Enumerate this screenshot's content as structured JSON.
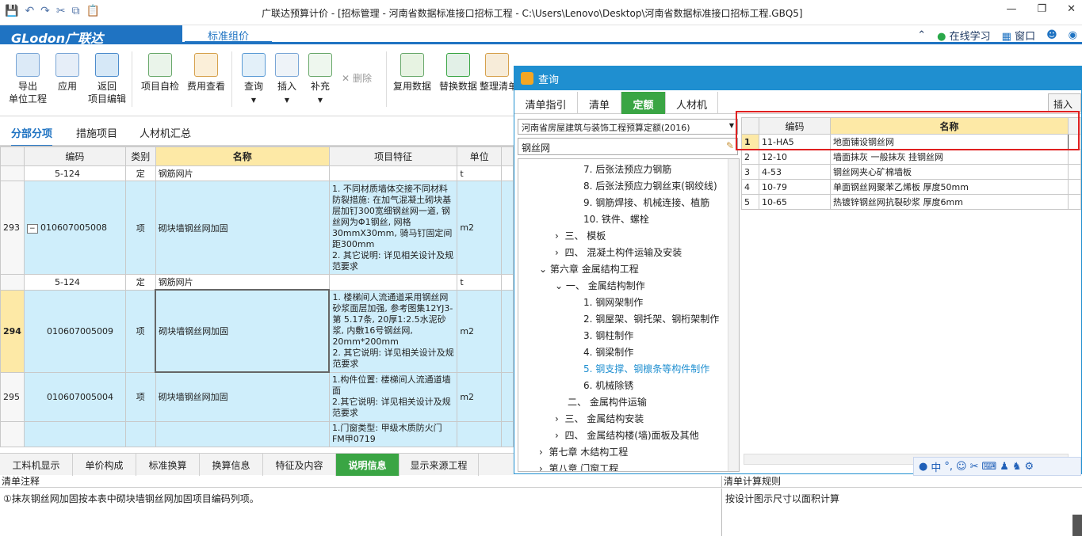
{
  "window": {
    "title": "广联达预算计价 - [招标管理 - 河南省数据标准接口招标工程 - C:\\Users\\Lenovo\\Desktop\\河南省数据标准接口招标工程.GBQ5]"
  },
  "brand": {
    "logo": "GLodon广联达",
    "tab_std": "标准组价",
    "online": "在线学习",
    "window": "窗口"
  },
  "ribbon": {
    "buttons": [
      "导出\n单位工程",
      "应用",
      "返回\n项目编辑",
      "项目自检",
      "费用查看",
      "查询",
      "插入",
      "补充",
      "删除",
      "复用数据",
      "替换数据",
      "整理清单"
    ]
  },
  "subtabs": [
    "分部分项",
    "措施项目",
    "人材机汇总"
  ],
  "grid": {
    "columns": [
      "编码",
      "类别",
      "名称",
      "项目特征",
      "单位"
    ],
    "rows": [
      {
        "num": "",
        "code": "5-124",
        "type": "定",
        "name": "钢筋网片",
        "feature": "",
        "unit": "t",
        "sub": true
      },
      {
        "num": "293",
        "code": "010607005008",
        "type": "项",
        "name": "砌块墙钢丝网加固",
        "feature": "1. 不同材质墙体交接不同材料防裂措施: 在加气混凝土砌块基层加钉300宽细钢丝网一道, 钢丝网为Φ1钢丝, 网格30mmX30mm, 骑马钉固定间距300mm\n2. 其它说明: 详见相关设计及规范要求",
        "unit": "m2",
        "sub": false
      },
      {
        "num": "",
        "code": "5-124",
        "type": "定",
        "name": "钢筋网片",
        "feature": "",
        "unit": "t",
        "sub": true
      },
      {
        "num": "294",
        "code": "010607005009",
        "type": "项",
        "name": "砌块墙钢丝网加固",
        "feature": "1. 楼梯间人流通道采用钢丝网砂浆面层加强, 参考图集12YJ3-第 5.17条, 20厚1:2.5水泥砂浆, 内敷16号钢丝网, 20mm*200mm\n2. 其它说明: 详见相关设计及规范要求",
        "unit": "m2",
        "sub": false
      },
      {
        "num": "295",
        "code": "010607005004",
        "type": "项",
        "name": "砌块墙钢丝网加固",
        "feature": "1.构件位置: 楼梯间人流通道墙面\n2.其它说明: 详见相关设计及规范要求",
        "unit": "m2",
        "sub": false
      },
      {
        "num": "",
        "code": "",
        "type": "",
        "name": "",
        "feature": "1.门窗类型: 甲级木质防火门FM甲0719",
        "unit": "",
        "sub": false
      }
    ]
  },
  "bottom_tabs": [
    "工料机显示",
    "单价构成",
    "标准换算",
    "换算信息",
    "特征及内容",
    "说明信息",
    "显示来源工程"
  ],
  "bottom": {
    "left_head": "清单注释",
    "left_body": "①抹灰钢丝网加固按本表中砌块墙钢丝网加固项目编码列项。",
    "right_head": "清单计算规则",
    "right_body": "按设计图示尺寸以面积计算"
  },
  "dialog": {
    "title": "查询",
    "tabs": [
      "清单指引",
      "清单",
      "定额",
      "人材机"
    ],
    "insert": "插入",
    "quota_lib": "河南省房屋建筑与装饰工程预算定额(2016)",
    "search": "钢丝网",
    "tree": [
      "7. 后张法预应力钢筋",
      "8. 后张法预应力钢丝束(钢绞线)",
      "9. 钢筋焊接、机械连接、植筋",
      "10. 铁件、螺栓",
      "三、 模板",
      "四、 混凝土构件运输及安装",
      "第六章 金属结构工程",
      "一、 金属结构制作",
      "1. 钢网架制作",
      "2. 钢屋架、钢托架、钢桁架制作",
      "3. 钢柱制作",
      "4. 钢梁制作",
      "5. 钢支撑、钢檩条等构件制作",
      "6. 机械除锈",
      "二、 金属构件运输",
      "三、 金属结构安装",
      "四、 金属结构楼(墙)面板及其他",
      "第七章 木结构工程",
      "第八章 门窗工程"
    ],
    "result_columns": [
      "编码",
      "名称"
    ],
    "results": [
      {
        "n": "1",
        "code": "11-HA5",
        "name": "地面铺设钢丝网"
      },
      {
        "n": "2",
        "code": "12-10",
        "name": "墙面抹灰 一般抹灰 挂钢丝网"
      },
      {
        "n": "3",
        "code": "4-53",
        "name": "钢丝网夹心矿棉墙板"
      },
      {
        "n": "4",
        "code": "10-79",
        "name": "单面钢丝网聚苯乙烯板 厚度50mm"
      },
      {
        "n": "5",
        "code": "10-65",
        "name": "热镀锌钢丝网抗裂砂浆 厚度6mm"
      }
    ]
  },
  "ime": {
    "lang": "中"
  }
}
